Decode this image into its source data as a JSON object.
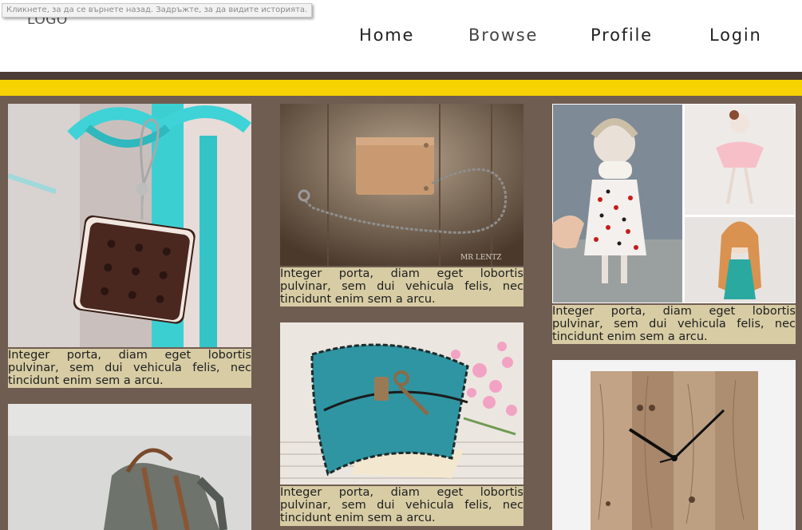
{
  "header": {
    "logo": "LOGO",
    "tooltip": "Кликнете, за да се върнете назад. Задръжте, за да видите историята.",
    "nav": [
      {
        "label": "Home"
      },
      {
        "label": "Browse"
      },
      {
        "label": "Profile"
      },
      {
        "label": "Login"
      }
    ]
  },
  "colors": {
    "page_background": "#6f5d52",
    "accent_bar": "#f6d300",
    "caption_background": "#d7cca4"
  },
  "cards": [
    {
      "image": "cookie-earring",
      "caption": "Integer porta, diam eget lobortis pulvinar, sem dui vehicula felis, nec tincidunt enim sem a arcu."
    },
    {
      "image": "leather-backpack",
      "caption": ""
    },
    {
      "image": "leather-wallet-chain",
      "caption": "Integer porta, diam eget lobortis pulvinar, sem dui vehicula felis, nec tincidunt enim sem a arcu.",
      "watermark": "MR LENTZ"
    },
    {
      "image": "teal-leather-journal",
      "caption": "Integer porta, diam eget lobortis pulvinar, sem dui vehicula felis, nec tincidunt enim sem a arcu."
    },
    {
      "image": "handmade-dolls",
      "caption": "Integer porta, diam eget lobortis pulvinar, sem dui vehicula felis, nec tincidunt enim sem a arcu."
    },
    {
      "image": "wooden-clock",
      "caption": ""
    }
  ]
}
